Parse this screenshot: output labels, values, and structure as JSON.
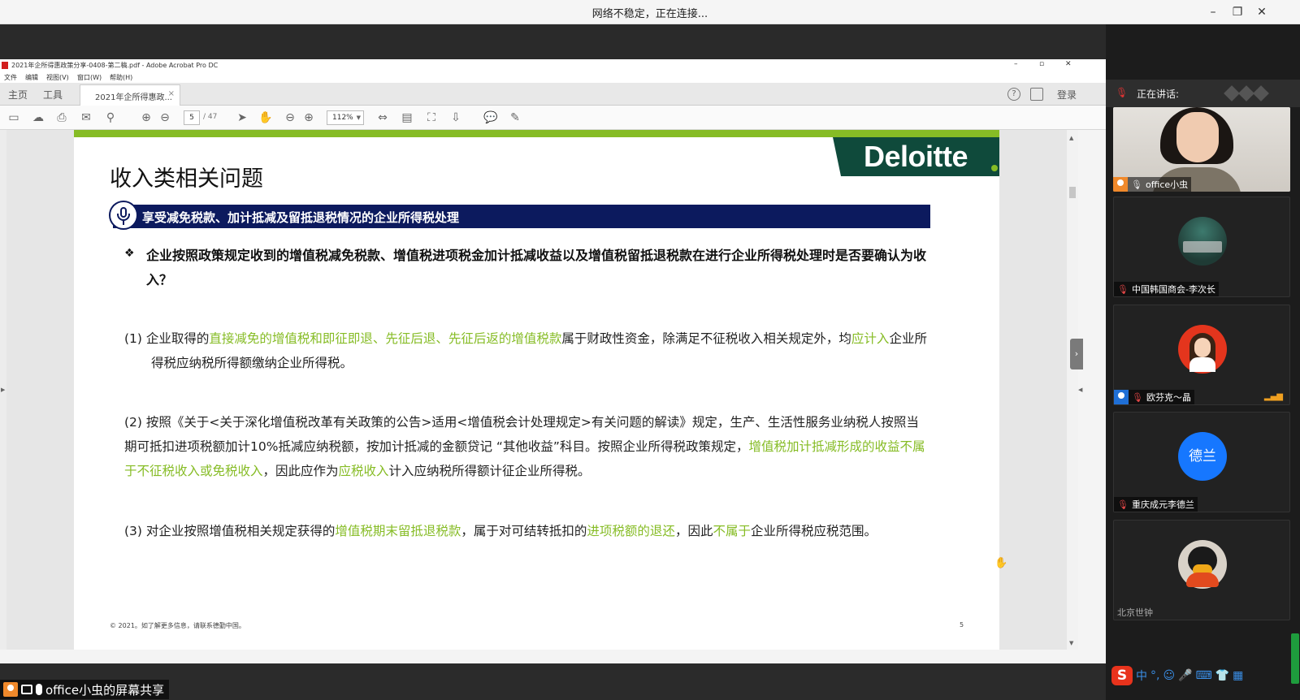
{
  "meeting": {
    "status": "网络不稳定，正在连接...",
    "share_label": "office小虫的屏幕共享"
  },
  "acrobat": {
    "window_title": "2021年企所得惠政策分享-0408-第二稿.pdf - Adobe Acrobat Pro DC",
    "menu": [
      "文件",
      "编辑",
      "视图(V)",
      "窗口(W)",
      "帮助(H)"
    ],
    "tabs": {
      "home": "主页",
      "tools": "工具",
      "doc": "2021年企所得惠政...",
      "login": "登录"
    },
    "page_current": "5",
    "page_total": "/ 47",
    "zoom": "112%"
  },
  "page": {
    "brand": "Deloitte",
    "title": "收入类相关问题",
    "section": "享受减免税款、加计抵减及留抵退税情况的企业所得税处理",
    "question": "企业按照政策规定收到的增值税减免税款、增值税进项税金加计抵减收益以及增值税留抵退税款在进行企业所得税处理时是否要确认为收入？",
    "p1": {
      "a": "(1) 企业取得的",
      "b": "直接减免的增值税和即征即退、先征后退、先征后返的增值税款",
      "c": "属于财政性资金，除满足不征税收入相关规定外，均",
      "d": "应计入",
      "e": "企业所得税应纳税所得额缴纳企业所得税。"
    },
    "p2": {
      "a": "(2) 按照《关于<关于深化增值税改革有关政策的公告>适用<增值税会计处理规定>有关问题的解读》规定，生产、生活性服务业纳税人按照当期可抵扣进项税额加计10%抵减应纳税额，按加计抵减的金额贷记 “其他收益”科目。按照企业所得税政策规定，",
      "b": "增值税加计抵减形成的收益不属于不征税收入或免税收入",
      "c": "，因此应作为",
      "d": "应税收入",
      "e": "计入应纳税所得额计征企业所得税。"
    },
    "p3": {
      "a": "(3) 对企业按照增值税相关规定获得的",
      "b": "增值税期末留抵退税款",
      "c": "，属于对可结转抵扣的",
      "d": "进项税额的退还",
      "e": "，因此",
      "f": "不属于",
      "g": "企业所得税应税范围。"
    },
    "footer": "© 2021。如了解更多信息，请联系德勤中国。",
    "page_number": "5"
  },
  "panel": {
    "speaking_label": "正在讲话:",
    "participants": [
      {
        "name": "office小虫"
      },
      {
        "name": "中国韩国商会-李次长"
      },
      {
        "name": "欧芬克～晶"
      },
      {
        "name": "重庆成元李德兰",
        "avatar_text": "德兰"
      },
      {
        "name": "北京世钟"
      }
    ]
  },
  "tray": {
    "ime": "中"
  },
  "colors": {
    "accent_green": "#86bc25",
    "navy": "#0c1a5e",
    "brand_dark": "#0f4a3b"
  }
}
